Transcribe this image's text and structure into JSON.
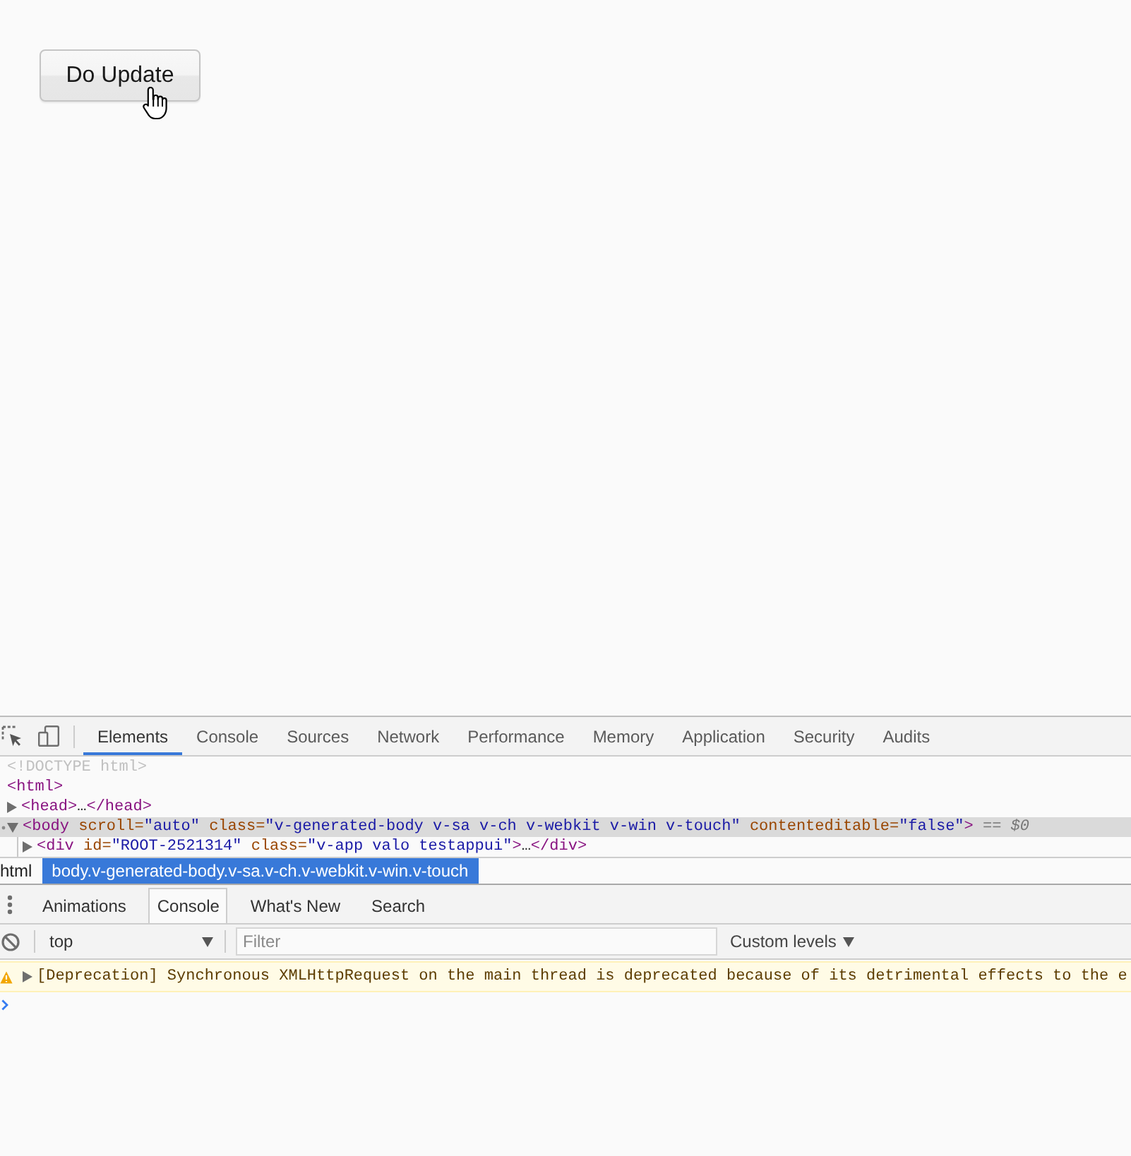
{
  "page": {
    "button": {
      "label": "Do Update"
    }
  },
  "devtools": {
    "tabs": [
      {
        "label": "Elements",
        "selected": true
      },
      {
        "label": "Console",
        "selected": false
      },
      {
        "label": "Sources",
        "selected": false
      },
      {
        "label": "Network",
        "selected": false
      },
      {
        "label": "Performance",
        "selected": false
      },
      {
        "label": "Memory",
        "selected": false
      },
      {
        "label": "Application",
        "selected": false
      },
      {
        "label": "Security",
        "selected": false
      },
      {
        "label": "Audits",
        "selected": false
      }
    ],
    "dom_tree": [
      {
        "kind": "doctype",
        "text": "<!DOCTYPE html>",
        "selected": false
      },
      {
        "kind": "element",
        "text": "<html>",
        "selected": false,
        "children": [
          {
            "kind": "element",
            "text": "<head>…</head>",
            "expanded": false,
            "selected": false
          },
          {
            "kind": "element",
            "text": "<body scroll=\"auto\" class=\"v-generated-body v-sa v-ch v-webkit v-win v-touch\" contenteditable=\"false\">",
            "note": "== *$0*",
            "expanded": true,
            "selected": true,
            "children": [
              {
                "kind": "element",
                "text": "<div id=\"ROOT-2521314\" class=\"v-app valo testappui\">…</div>",
                "expanded": false,
                "selected": false
              }
            ]
          }
        ]
      }
    ],
    "breadcrumbs": [
      {
        "label": "html",
        "selected": false
      },
      {
        "label": "body.v-generated-body.v-sa.v-ch.v-webkit.v-win.v-touch",
        "selected": true
      }
    ],
    "drawer": {
      "tabs": [
        {
          "label": "Animations",
          "selected": false
        },
        {
          "label": "Console",
          "selected": true
        },
        {
          "label": "What's New",
          "selected": false
        },
        {
          "label": "Search",
          "selected": false
        }
      ],
      "console": {
        "context": "top",
        "filter": {
          "placeholder": "Filter"
        },
        "levels": "Custom levels",
        "messages": [
          {
            "kind": "warning",
            "expanded": false,
            "text": "[Deprecation] Synchronous XMLHttpRequest on the main thread is deprecated because of its detrimental effects to the e"
          }
        ]
      }
    }
  }
}
